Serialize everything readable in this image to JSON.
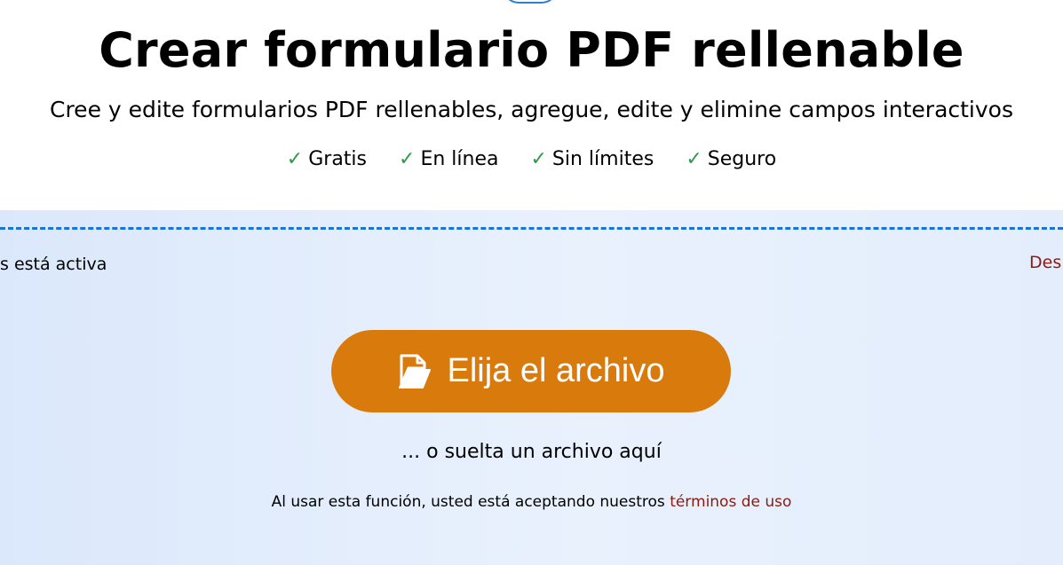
{
  "header": {
    "title": "Crear formulario PDF rellenable",
    "subtitle": "Cree y edite formularios PDF rellenables, agregue, edite y elimine campos interactivos"
  },
  "features": [
    {
      "check": "✓",
      "label": "Gratis"
    },
    {
      "check": "✓",
      "label": "En línea"
    },
    {
      "check": "✓",
      "label": "Sin límites"
    },
    {
      "check": "✓",
      "label": "Seguro"
    }
  ],
  "dropzone": {
    "status_left": "s está activa",
    "status_right": "Des",
    "choose_button_label": "Elija el archivo",
    "drop_hint": "... o suelta un archivo aquí",
    "terms_text": "Al usar esta función, usted está aceptando nuestros ",
    "terms_link": "términos de uso"
  },
  "icons": {
    "check": "check-icon",
    "folder": "folder-open-icon"
  },
  "colors": {
    "button": "#d97b0c",
    "check": "#2e9a4b",
    "link": "#8b1a10",
    "dashed_border": "#1a73d6"
  }
}
